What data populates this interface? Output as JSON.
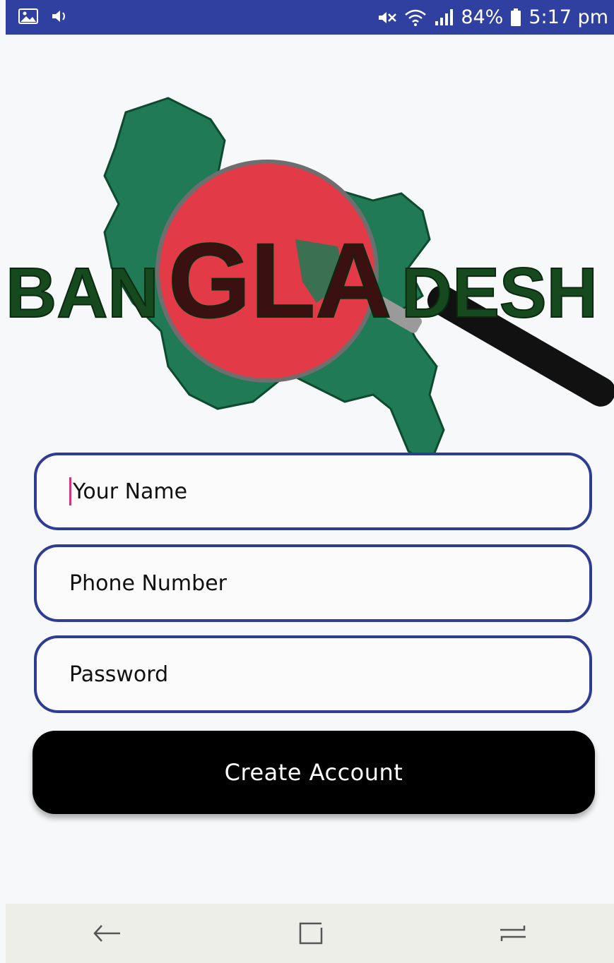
{
  "status_bar": {
    "battery": "84%",
    "time": "5:17 pm",
    "icons": [
      "gallery-icon",
      "volume-icon",
      "mute-icon",
      "wifi-icon",
      "signal-icon",
      "battery-icon"
    ],
    "background": "#3040a0"
  },
  "logo": {
    "text_left": "BAN",
    "text_center": "GLA",
    "text_right": "DESH",
    "colors": {
      "map_green": "#1f7a55",
      "flag_red": "#e33a48",
      "text_green": "#164a1e"
    }
  },
  "form": {
    "name_placeholder": "Your Name",
    "phone_placeholder": "Phone Number",
    "password_placeholder": "Password",
    "submit_label": "Create Account",
    "border_color": "#2e3c92",
    "cursor_color": "#d2357a"
  },
  "nav_bar": {
    "buttons": [
      "back-icon",
      "recents-icon",
      "home-icon"
    ]
  }
}
